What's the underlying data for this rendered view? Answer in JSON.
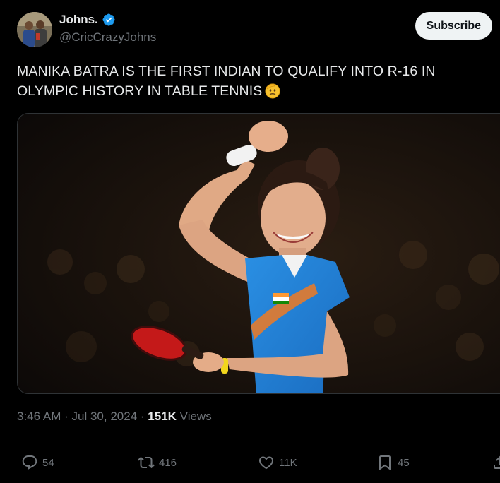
{
  "author": {
    "display_name": "Johns.",
    "handle": "@CricCrazyJohns",
    "avatar_icon": "profile-photo",
    "verified_icon": "verified-badge-icon"
  },
  "subscribe_label": "Subscribe",
  "tweet_text": "MANIKA BATRA IS THE FIRST INDIAN TO QUALIFY INTO R-16 IN OLYMPIC HISTORY IN TABLE TENNIS",
  "emoji_icon": "saluting-face-emoji",
  "media_icon": "athlete-celebrating-photo",
  "meta": {
    "time": "3:46 AM",
    "separator": "·",
    "date": "Jul 30, 2024",
    "views_count": "151K",
    "views_label": "Views"
  },
  "actions": {
    "replies": "54",
    "reposts": "416",
    "likes": "11K",
    "bookmarks": "45"
  },
  "colors": {
    "background": "#000000",
    "text_primary": "#e7e9ea",
    "text_secondary": "#71767b",
    "verified_blue": "#1d9bf0",
    "subscribe_bg": "#eff3f4",
    "divider": "#2f3336"
  }
}
